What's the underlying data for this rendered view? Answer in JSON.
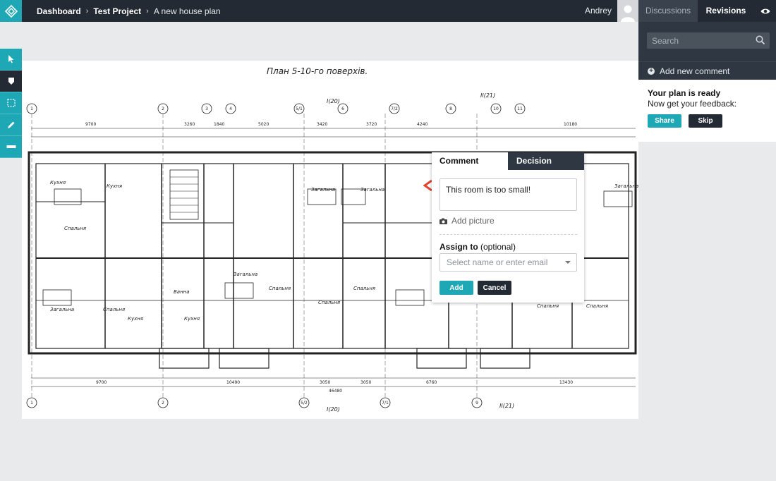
{
  "header": {
    "breadcrumb": [
      "Dashboard",
      "Test Project",
      "A new house plan"
    ],
    "separator": "›",
    "user_name": "Andrey",
    "tabs": {
      "discussions": "Discussions",
      "revisions": "Revisions"
    }
  },
  "tools": [
    {
      "icon": "cursor-icon",
      "active": false
    },
    {
      "icon": "comment-pin-icon",
      "active": true
    },
    {
      "icon": "rectangle-select-icon",
      "active": false
    },
    {
      "icon": "pencil-icon",
      "active": false
    },
    {
      "icon": "ruler-icon",
      "active": false
    }
  ],
  "plan": {
    "title": "План 5-10-го поверхів.",
    "axis_labels_top": [
      "1",
      "2",
      "3",
      "4",
      "5/1",
      "6",
      "7/2",
      "8",
      "10",
      "11"
    ],
    "axis_labels_bottom": [
      "1",
      "2",
      "5/2",
      "7/1",
      "9"
    ],
    "section_marks": [
      "I(20)",
      "II(21)"
    ],
    "dimensions": [
      "9700",
      "3260",
      "1840",
      "5020",
      "3420",
      "3720",
      "4240",
      "10180",
      "10490",
      "3050",
      "6760",
      "13430",
      "46480"
    ],
    "rooms": [
      "Кухня",
      "Спальня",
      "Загальна кімната",
      "Ванна",
      "Спальня"
    ]
  },
  "panel": {
    "search_placeholder": "Search",
    "add_comment": "Add new comment",
    "ready_title": "Your plan is ready",
    "ready_subtitle": "Now get your feedback:",
    "share": "Share",
    "skip": "Skip"
  },
  "popup": {
    "tab_comment": "Comment",
    "tab_decision": "Decision",
    "comment_text": "This room is too small!",
    "add_picture": "Add picture",
    "assign_label": "Assign to",
    "assign_optional": "(optional)",
    "assign_placeholder": "Select name or enter email",
    "add": "Add",
    "cancel": "Cancel"
  },
  "colors": {
    "accent": "#1ea7b5",
    "dark": "#232a33",
    "panel": "#2f3842",
    "marker": "#e0452e"
  }
}
